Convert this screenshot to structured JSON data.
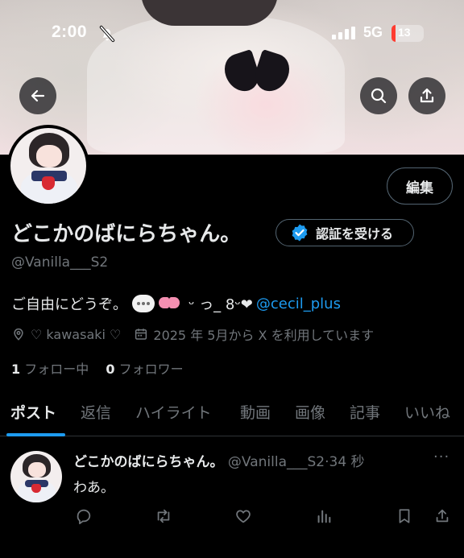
{
  "status_bar": {
    "time": "2:00",
    "network": "5G",
    "battery": "13",
    "battery_level": 0.13
  },
  "nav": {
    "back_icon": "arrow-left-icon",
    "search_icon": "search-icon",
    "share_icon": "share-icon"
  },
  "profile": {
    "edit_label": "編集",
    "display_name": "どこかのばにらちゃん。",
    "verify_label": "認証を受ける",
    "handle": "@Vanilla___S2",
    "bio_text": "ご自由にどうぞ。",
    "bio_kaomoji": "ᵕ っ_ 8ᵕ❤",
    "bio_link": "@cecil_plus",
    "location": "♡ kawasaki ♡",
    "joined": "2025 年 5月から X を利用しています",
    "following_count": "1",
    "following_label": "フォロー中",
    "followers_count": "0",
    "followers_label": "フォロワー"
  },
  "tabs": [
    {
      "label": "ポスト",
      "active": true
    },
    {
      "label": "返信"
    },
    {
      "label": "ハイライト"
    },
    {
      "label": "動画"
    },
    {
      "label": "画像"
    },
    {
      "label": "記事"
    },
    {
      "label": "いいね"
    }
  ],
  "post": {
    "author": "どこかのばにらちゃん。",
    "handle": "@Vanilla___S2",
    "separator": "·",
    "time": "34 秒",
    "more": "···",
    "text": "わあ。"
  },
  "colors": {
    "accent": "#1d9bf0",
    "background": "#000000",
    "muted": "#71767b",
    "border": "#2f3336"
  }
}
